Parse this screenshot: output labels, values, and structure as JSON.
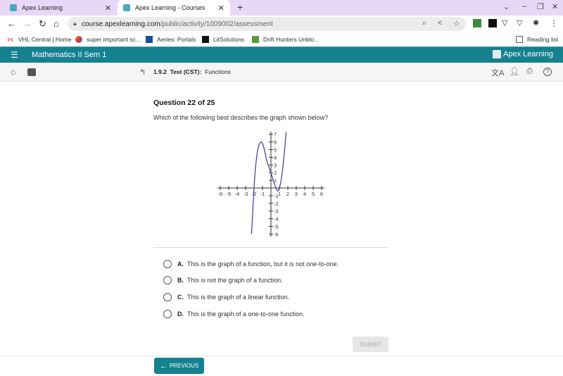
{
  "browser": {
    "tabs": [
      {
        "label": "Apex Learning",
        "active": false
      },
      {
        "label": "Apex Learning - Courses",
        "active": true
      }
    ],
    "new_tab": "+",
    "window_controls": {
      "tab_search": "⌄",
      "minimize": "–",
      "restore": "❐",
      "close": "✕"
    },
    "url": {
      "host": "course.apexlearning.com",
      "path": "/public/activity/1009002/assessment"
    },
    "bookmarks": [
      {
        "label": "VHL Central | Home",
        "icon": "vhl-icon",
        "color": "#d9534f"
      },
      {
        "label": "super important sc...",
        "icon": "colorful-icon",
        "color": "#e6a100"
      },
      {
        "label": "Aeries: Portals",
        "icon": "aeries-icon",
        "color": "#1a4fa0"
      },
      {
        "label": "LitSolutions",
        "icon": "litsolutions-icon",
        "color": "#111111"
      },
      {
        "label": "Drift Hunters Unblo...",
        "icon": "game-icon",
        "color": "#5a9a3a"
      }
    ],
    "reading_list": "Reading list"
  },
  "app": {
    "course_title": "Mathematics II Sem 1",
    "brand": "Apex Learning",
    "brand_color": "#15818f",
    "breadcrumb": {
      "number": "1.9.2",
      "type": "Test (CST):",
      "name": "Functions"
    }
  },
  "question": {
    "counter": "Question 22 of 25",
    "prompt": "Which of the following best describes the graph shown below?",
    "options": [
      {
        "letter": "A.",
        "text": "This is the graph of a function, but it is not one-to-one."
      },
      {
        "letter": "B.",
        "text": "This is not the graph of a function."
      },
      {
        "letter": "C.",
        "text": "This is the graph of a linear function."
      },
      {
        "letter": "D.",
        "text": "This is the graph of a one-to-one function."
      }
    ],
    "submit_label": "SUBMIT",
    "previous_label": "PREVIOUS"
  },
  "chart_data": {
    "type": "line",
    "title": "",
    "xlabel": "",
    "ylabel": "",
    "xlim": [
      -6,
      6
    ],
    "ylim": [
      -6,
      7
    ],
    "x_ticks": [
      -6,
      -5,
      -4,
      -3,
      -2,
      -1,
      1,
      2,
      3,
      4,
      5,
      6
    ],
    "y_ticks": [
      7,
      6,
      5,
      4,
      3,
      2,
      1,
      -1,
      -2,
      -3,
      -4,
      -5,
      -6
    ],
    "series": [
      {
        "name": "curve",
        "color": "#4a4a9a",
        "x": [
          -2.3,
          -2.0,
          -1.8,
          -1.5,
          -1.2,
          -1.0,
          -0.8,
          -0.5,
          -0.2,
          0.0,
          0.3,
          0.6,
          0.8,
          1.0,
          1.2,
          1.4,
          1.6,
          1.8
        ],
        "y": [
          -6.0,
          0.0,
          3.0,
          5.3,
          6.0,
          5.8,
          5.1,
          3.6,
          2.6,
          2.0,
          0.9,
          0.0,
          -0.4,
          0.0,
          1.0,
          2.6,
          4.8,
          7.3
        ]
      }
    ]
  }
}
